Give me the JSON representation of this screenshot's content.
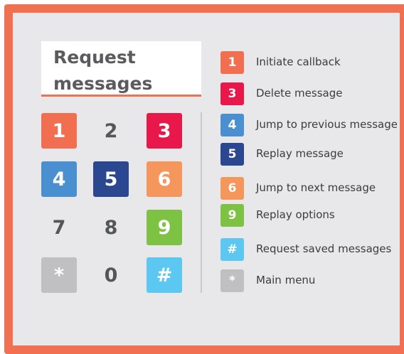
{
  "title": "Request messages",
  "colors": {
    "border": "#f27052",
    "background": "#e8e8ea",
    "red_orange": "#f26e50",
    "crimson": "#e8184a",
    "blue": "#4a8fd0",
    "navy": "#2b4790",
    "orange": "#f5965c",
    "green": "#7dc243",
    "light_blue": "#5cc8f2",
    "gray": "#c0c0c2"
  },
  "keypad": [
    {
      "label": "1",
      "style": "red_orange"
    },
    {
      "label": "2",
      "style": "plain"
    },
    {
      "label": "3",
      "style": "crimson"
    },
    {
      "label": "4",
      "style": "blue"
    },
    {
      "label": "5",
      "style": "navy"
    },
    {
      "label": "6",
      "style": "orange"
    },
    {
      "label": "7",
      "style": "plain"
    },
    {
      "label": "8",
      "style": "plain"
    },
    {
      "label": "9",
      "style": "green"
    },
    {
      "label": "*",
      "style": "gray"
    },
    {
      "label": "0",
      "style": "plain"
    },
    {
      "label": "#",
      "style": "light_blue"
    }
  ],
  "legend": [
    {
      "key": "1",
      "text": "Initiate callback",
      "style": "red_orange"
    },
    {
      "key": "3",
      "text": "Delete message",
      "style": "crimson"
    },
    {
      "key": "4",
      "text": "Jump to previous message",
      "style": "blue"
    },
    {
      "key": "5",
      "text": "Replay message",
      "style": "navy"
    },
    {
      "key": "6",
      "text": "Jump to next message",
      "style": "orange"
    },
    {
      "key": "9",
      "text": "Replay options",
      "style": "green"
    },
    {
      "key": "#",
      "text": "Request saved messages",
      "style": "light_blue"
    },
    {
      "key": "*",
      "text": "Main menu",
      "style": "gray"
    }
  ]
}
